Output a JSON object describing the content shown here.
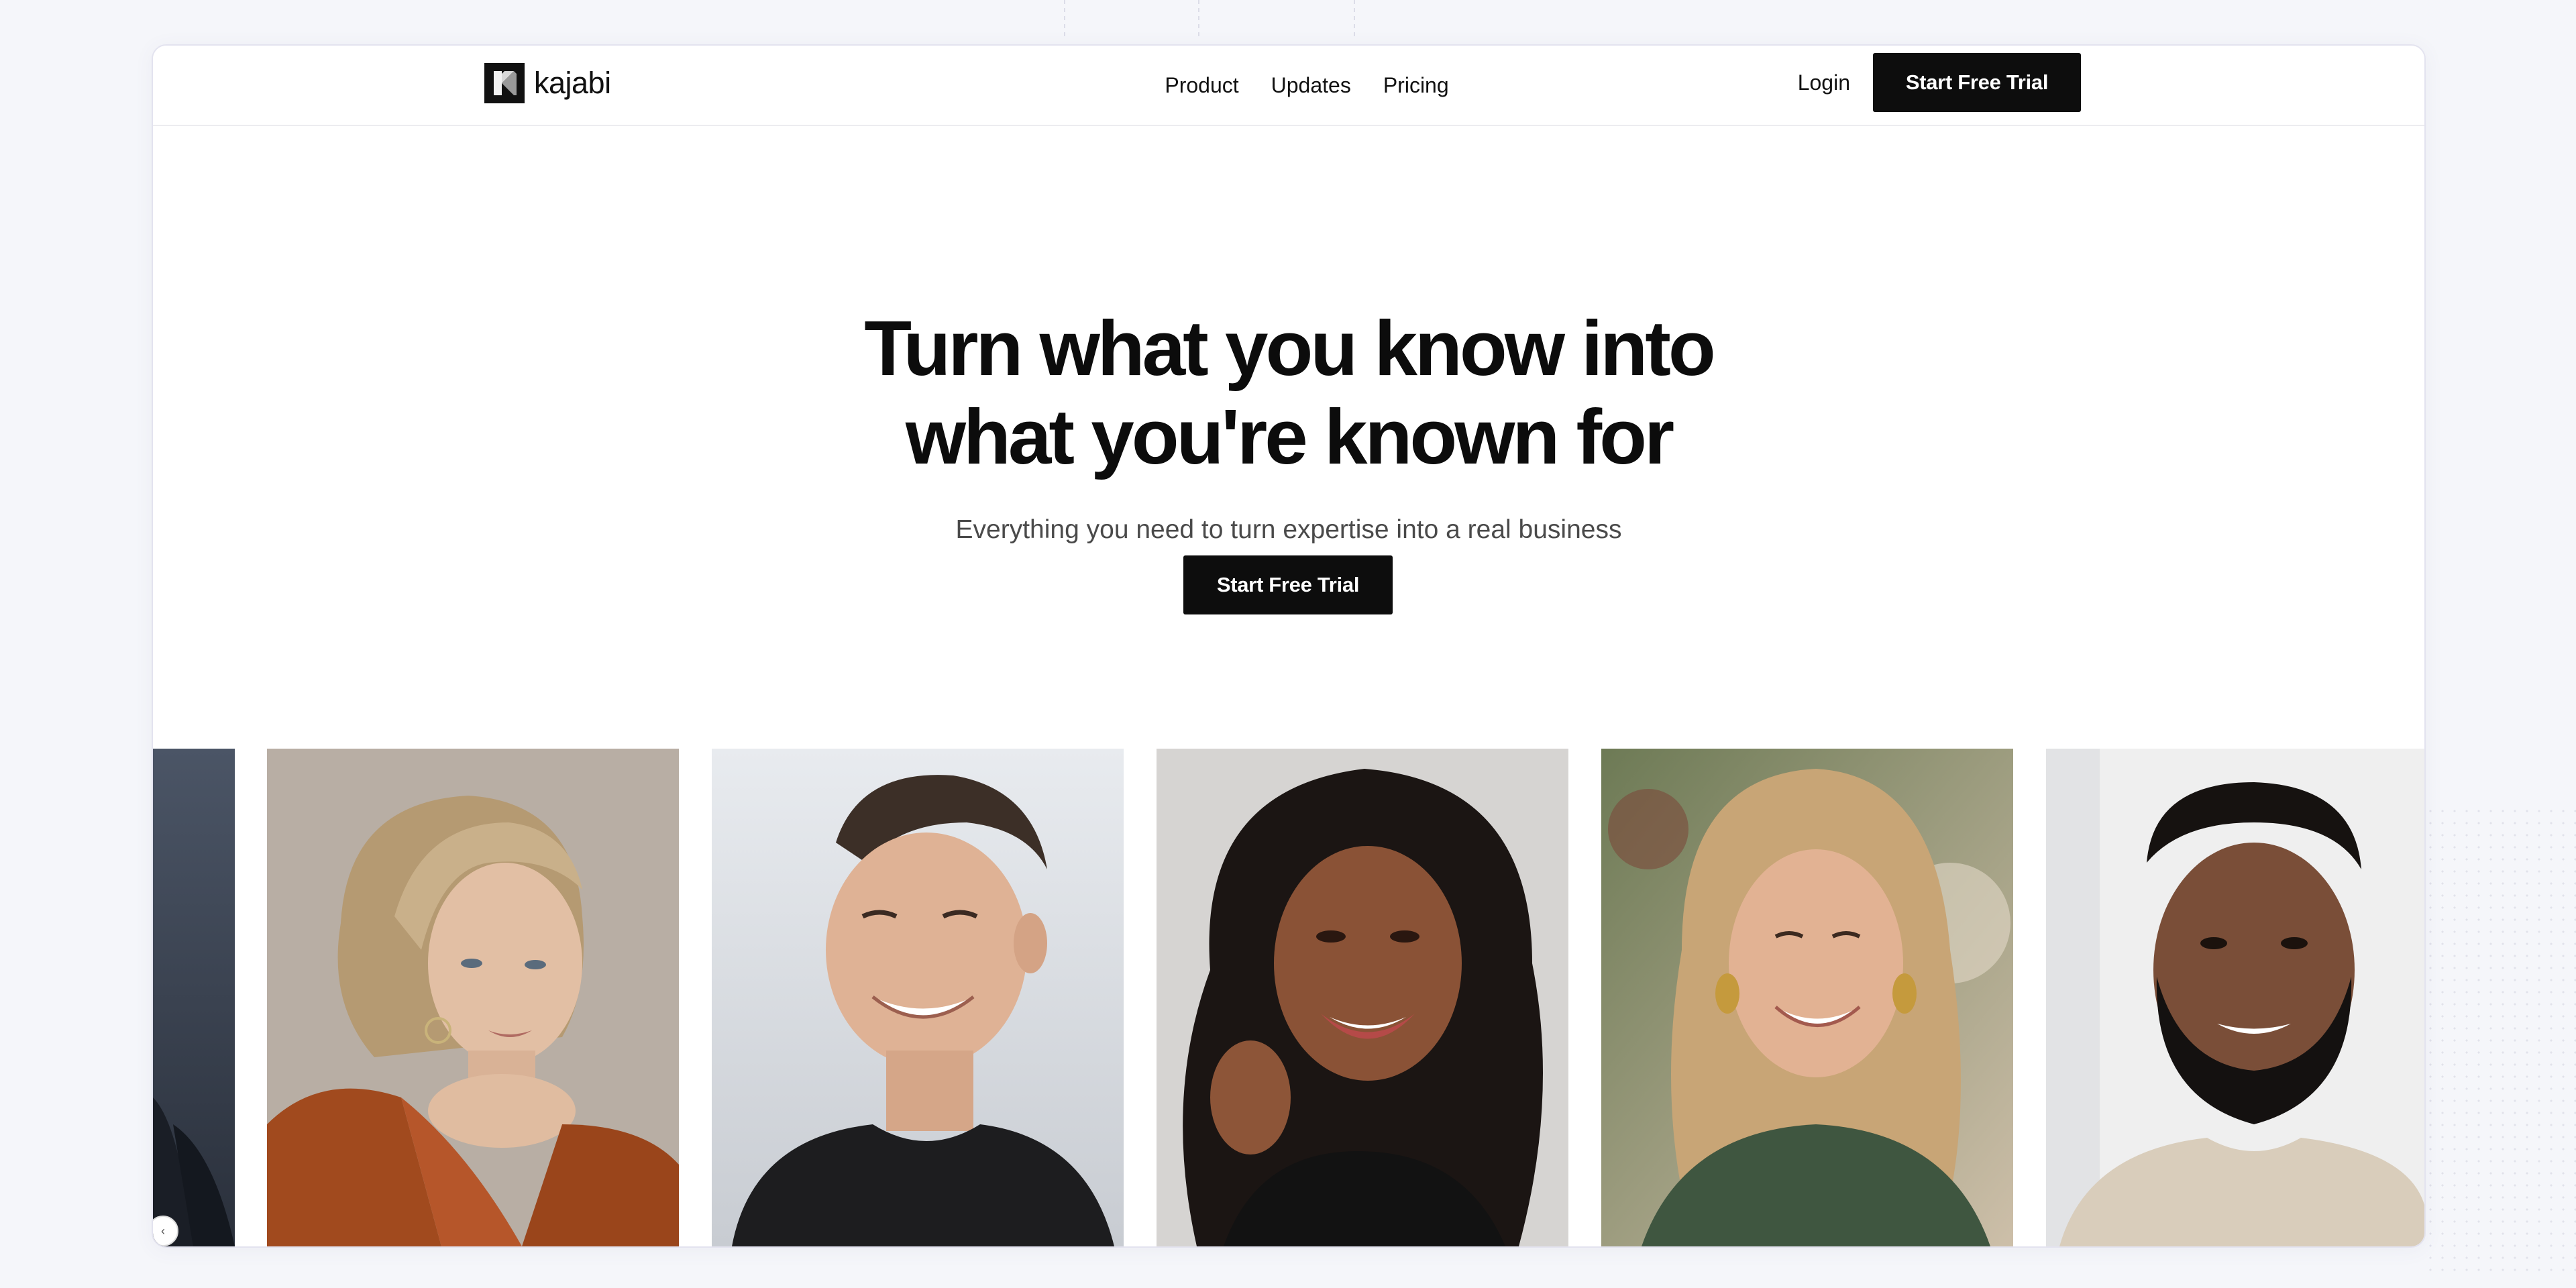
{
  "nav": {
    "logo_text": "kajabi",
    "links": [
      {
        "label": "Product"
      },
      {
        "label": "Updates"
      },
      {
        "label": "Pricing"
      }
    ],
    "login_label": "Login",
    "cta_label": "Start Free Trial"
  },
  "hero": {
    "title_line1": "Turn what you know into",
    "title_line2": "what you're known for",
    "subtitle": "Everything you need to turn expertise into a real business",
    "cta_label": "Start Free Trial"
  },
  "photos": [
    {
      "subject": "partial portrait, dark suit"
    },
    {
      "subject": "woman with silver bob and rust jacket"
    },
    {
      "subject": "smiling man in black t-shirt"
    },
    {
      "subject": "smiling woman with long dark curly hair"
    },
    {
      "subject": "smiling woman with long blonde hair"
    },
    {
      "subject": "smiling bearded man in beige t-shirt"
    }
  ],
  "colors": {
    "cta_bg": "#0d0d0d",
    "cta_text": "#ffffff",
    "page_bg": "#ffffff",
    "backdrop": "#f5f6fa"
  }
}
